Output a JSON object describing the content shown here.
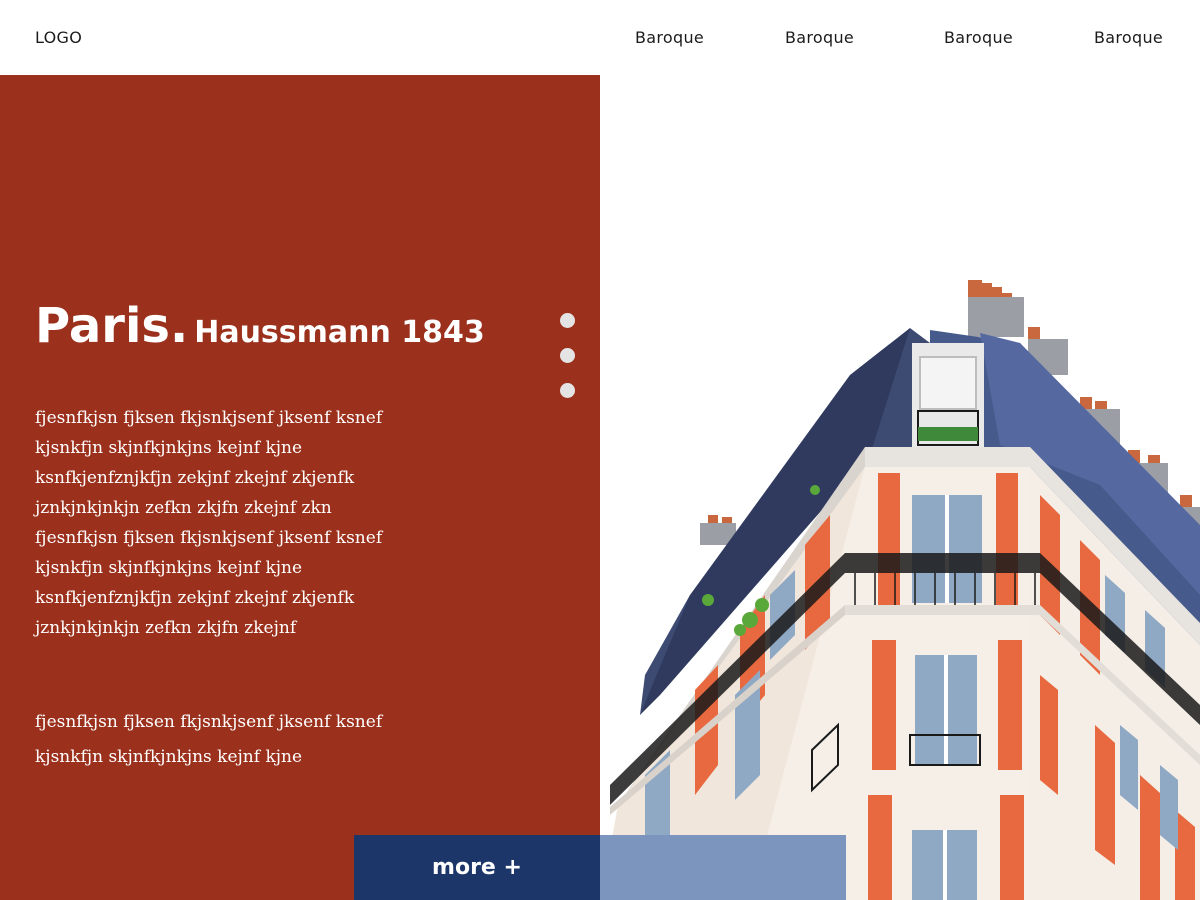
{
  "header": {
    "logo": "LOGO",
    "nav": [
      "Baroque",
      "Baroque",
      "Baroque",
      "Baroque"
    ]
  },
  "hero": {
    "title": "Paris.",
    "subtitle": "Haussmann 1843",
    "paragraph_1": [
      "fjesnfkjsn fjksen fkjsnkjsenf jksenf ksnef",
      "kjsnkfjn skjnfkjnkjns kejnf kjne",
      "ksnfkjenfznjkfjn zekjnf zkejnf zkjenfk",
      "jznkjnkjnkjn zefkn zkjfn zkejnf zkn",
      "fjesnfkjsn fjksen fkjsnkjsenf jksenf ksnef",
      "kjsnkfjn skjnfkjnkjns kejnf kjne",
      "ksnfkjenfznjkfjn zekjnf zkejnf zkjenfk",
      "jznkjnkjnkjn zefkn zkjfn zkejnf"
    ],
    "paragraph_2": [
      "fjesnfkjsn fjksen fkjsnkjsenf jksenf ksnef",
      "kjsnkfjn skjnfkjnkjns kejnf kjne"
    ],
    "more_label": "more +",
    "slide_count": 3
  },
  "colors": {
    "panel": "#9b301c",
    "button": "#1c3669",
    "button_accent": "#7b95bf",
    "dot": "#e4e4e4",
    "roof": "#3d4a72",
    "facade_orange": "#e8693f"
  },
  "image": {
    "subject": "haussmann-building-photo"
  }
}
